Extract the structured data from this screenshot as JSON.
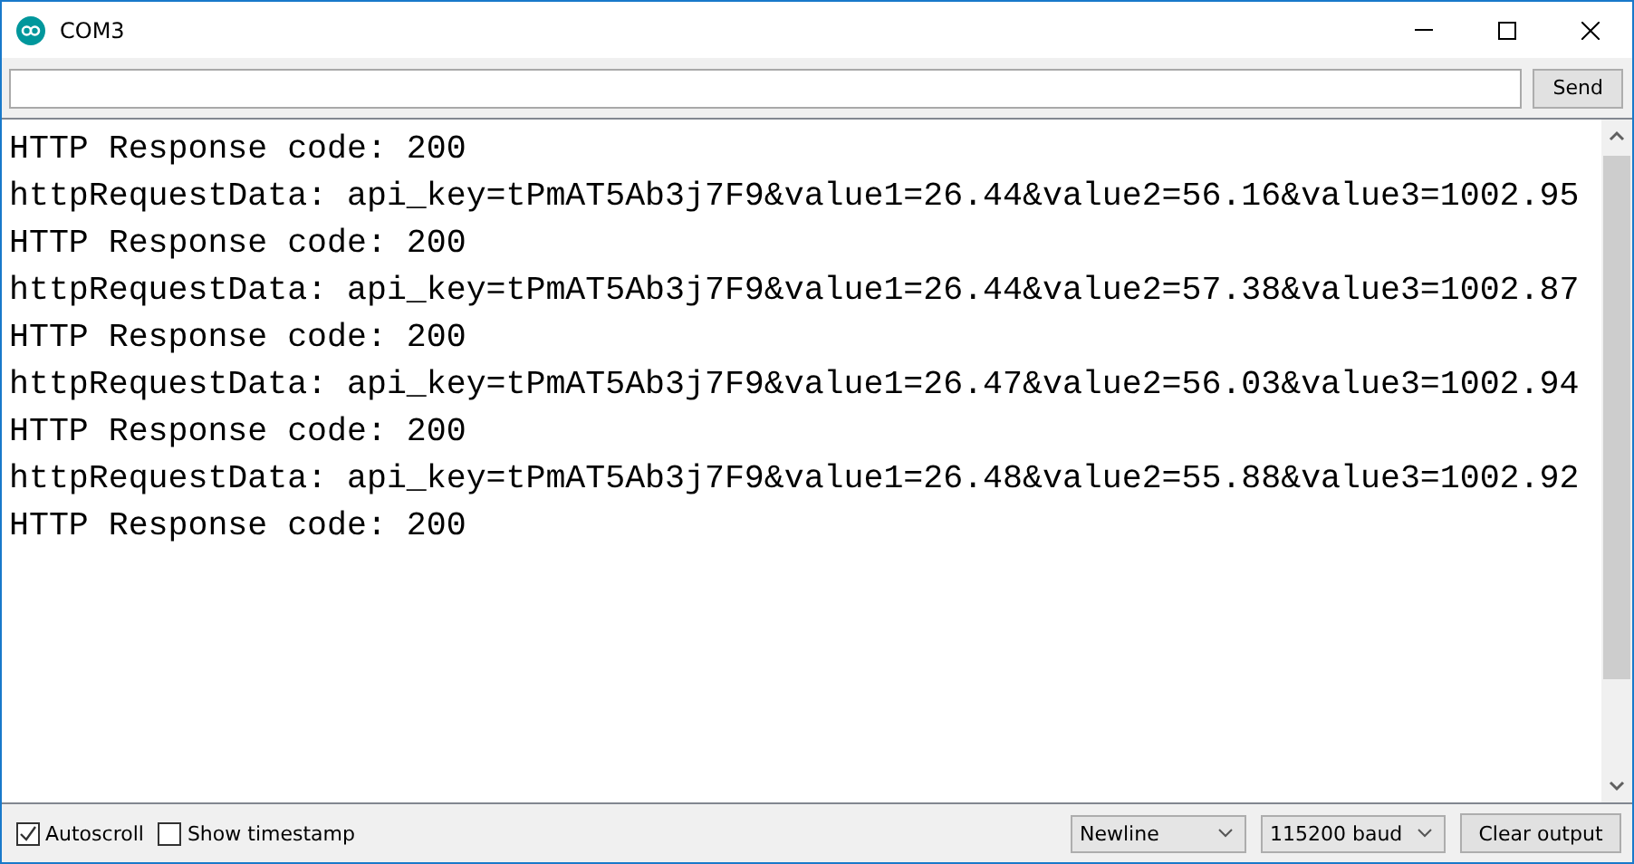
{
  "window": {
    "title": "COM3"
  },
  "send_button": "Send",
  "output_lines": [
    "HTTP Response code: 200",
    "httpRequestData: api_key=tPmAT5Ab3j7F9&value1=26.44&value2=56.16&value3=1002.95",
    "HTTP Response code: 200",
    "httpRequestData: api_key=tPmAT5Ab3j7F9&value1=26.44&value2=57.38&value3=1002.87",
    "HTTP Response code: 200",
    "httpRequestData: api_key=tPmAT5Ab3j7F9&value1=26.47&value2=56.03&value3=1002.94",
    "HTTP Response code: 200",
    "httpRequestData: api_key=tPmAT5Ab3j7F9&value1=26.48&value2=55.88&value3=1002.92",
    "HTTP Response code: 200"
  ],
  "checkboxes": [
    {
      "label": "Autoscroll",
      "checked": true
    },
    {
      "label": "Show timestamp",
      "checked": false
    }
  ],
  "line_ending": "Newline",
  "baud_rate": "115200 baud",
  "clear_button": "Clear output"
}
